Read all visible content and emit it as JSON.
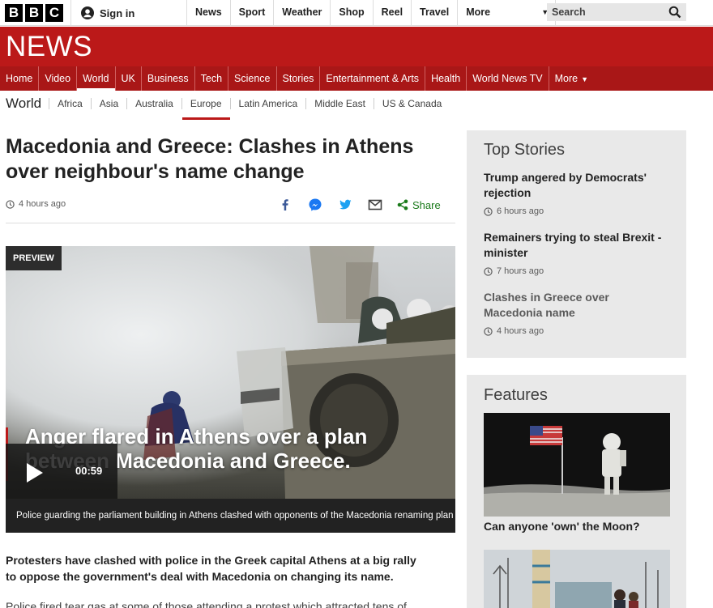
{
  "topbar": {
    "logo": "BBC",
    "signin_label": "Sign in",
    "nav": [
      "News",
      "Sport",
      "Weather",
      "Shop",
      "Reel",
      "Travel",
      "More"
    ],
    "search_placeholder": "Search"
  },
  "header": {
    "wordmark": "NEWS"
  },
  "main_nav": {
    "items": [
      "Home",
      "Video",
      "World",
      "UK",
      "Business",
      "Tech",
      "Science",
      "Stories",
      "Entertainment & Arts",
      "Health",
      "World News TV"
    ],
    "active": "World",
    "more_label": "More"
  },
  "section_nav": {
    "title": "World",
    "items": [
      "Africa",
      "Asia",
      "Australia",
      "Europe",
      "Latin America",
      "Middle East",
      "US & Canada"
    ],
    "active": "Europe"
  },
  "article": {
    "headline": "Macedonia and Greece: Clashes in Athens over neighbour's name change",
    "timestamp": "4 hours ago",
    "share_label": "Share",
    "media": {
      "badge": "PREVIEW",
      "overlay_text": "Anger flared in Athens over a plan between Macedonia and Greece.",
      "duration": "00:59",
      "caption": "Police guarding the parliament building in Athens clashed with opponents of the Macedonia renaming plan"
    },
    "lede": "Protesters have clashed with police in the Greek capital Athens at a big rally to oppose the government's deal with Macedonia on changing its name.",
    "body": "Police fired tear gas at some of those attending a protest which attracted tens of"
  },
  "sidebar": {
    "top_stories": {
      "heading": "Top Stories",
      "items": [
        {
          "title": "Trump angered by Democrats' rejection",
          "time": "6 hours ago"
        },
        {
          "title": "Remainers trying to steal Brexit - minister",
          "time": "7 hours ago"
        },
        {
          "title": "Clashes in Greece over Macedonia name",
          "time": "4 hours ago"
        }
      ]
    },
    "features": {
      "heading": "Features",
      "items": [
        {
          "title": "Can anyone 'own' the Moon?"
        }
      ]
    }
  },
  "colors": {
    "brand_red": "#bb1919",
    "nav_red": "#a91717",
    "share_green": "#1a7a1a",
    "facebook": "#3b5998",
    "twitter": "#1da1f2"
  }
}
